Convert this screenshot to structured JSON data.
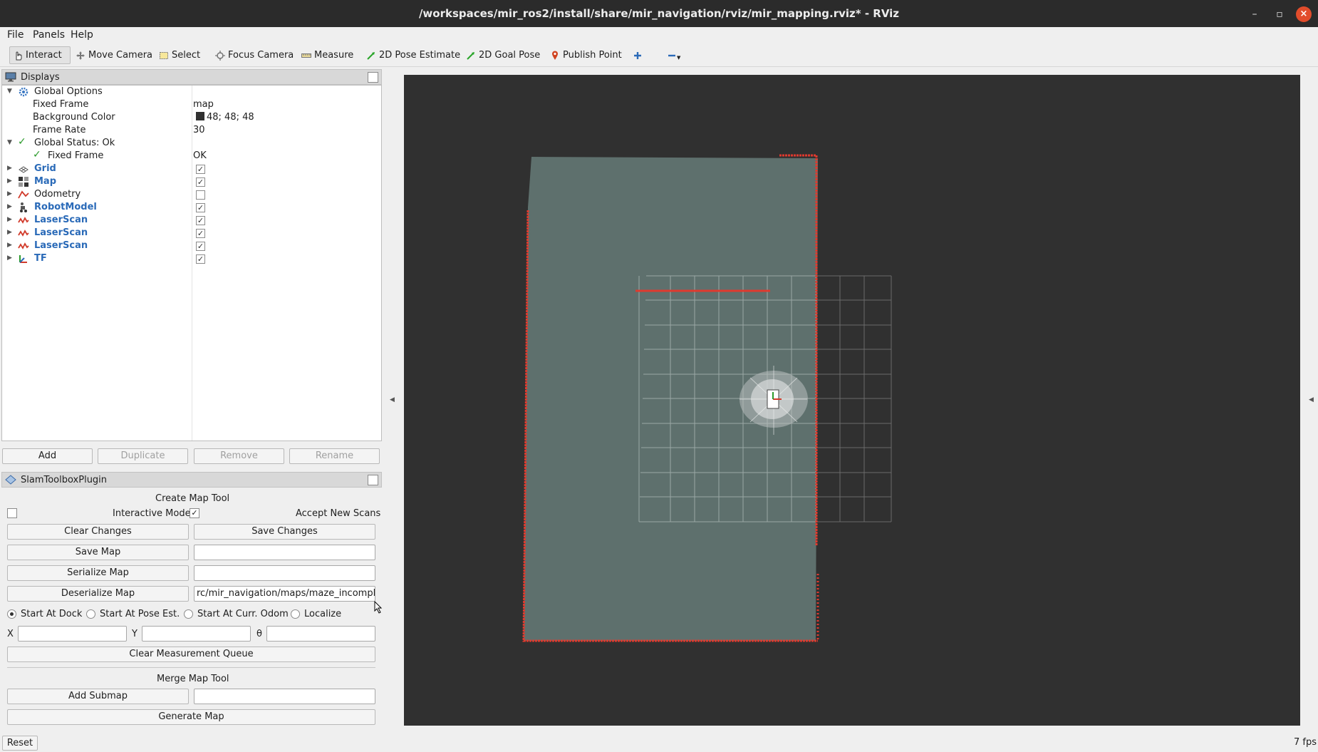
{
  "window": {
    "title": "/workspaces/mir_ros2/install/share/mir_navigation/rviz/mir_mapping.rviz* - RViz",
    "minimize": "–",
    "maximize": "▫",
    "close": "×"
  },
  "menubar": [
    "File",
    "Panels",
    "Help"
  ],
  "toolbar": [
    {
      "label": "Interact",
      "icon": "hand-pointer-icon"
    },
    {
      "label": "Move Camera",
      "icon": "move-camera-icon"
    },
    {
      "label": "Select",
      "icon": "select-icon"
    },
    {
      "label": "Focus Camera",
      "icon": "focus-camera-icon"
    },
    {
      "label": "Measure",
      "icon": "measure-icon"
    },
    {
      "label": "2D Pose Estimate",
      "icon": "pose-estimate-icon"
    },
    {
      "label": "2D Goal Pose",
      "icon": "goal-pose-icon"
    },
    {
      "label": "Publish Point",
      "icon": "publish-point-icon"
    }
  ],
  "displays": {
    "title": "Displays",
    "global_options": "Global Options",
    "fixed_frame_label": "Fixed Frame",
    "fixed_frame_value": "map",
    "bg_color_label": "Background Color",
    "bg_color_value": "48; 48; 48",
    "bg_color_hex": "#303030",
    "frame_rate_label": "Frame Rate",
    "frame_rate_value": "30",
    "global_status": "Global Status: Ok",
    "status_fixed_frame": "Fixed Frame",
    "status_fixed_frame_value": "OK",
    "items": [
      {
        "label": "Grid",
        "checked": true
      },
      {
        "label": "Map",
        "checked": true
      },
      {
        "label": "Odometry",
        "checked": false
      },
      {
        "label": "RobotModel",
        "checked": true
      },
      {
        "label": "LaserScan",
        "checked": true
      },
      {
        "label": "LaserScan",
        "checked": true
      },
      {
        "label": "LaserScan",
        "checked": true
      },
      {
        "label": "TF",
        "checked": true
      }
    ],
    "buttons": {
      "add": "Add",
      "duplicate": "Duplicate",
      "remove": "Remove",
      "rename": "Rename"
    }
  },
  "slam": {
    "title": "SlamToolboxPlugin",
    "create_map_tool": "Create Map Tool",
    "interactive_mode": "Interactive Mode",
    "accept_new_scans": "Accept New Scans",
    "clear_changes": "Clear Changes",
    "save_changes": "Save Changes",
    "save_map": "Save Map",
    "serialize_map": "Serialize Map",
    "deserialize_map": "Deserialize Map",
    "deserialize_path": "rc/mir_navigation/maps/maze_incomplete",
    "radios": [
      "Start At Dock",
      "Start At Pose Est.",
      "Start At Curr. Odom",
      "Localize"
    ],
    "x_label": "X",
    "y_label": "Y",
    "theta_label": "θ",
    "clear_measurement_queue": "Clear Measurement Queue",
    "merge_map_tool": "Merge Map Tool",
    "add_submap": "Add Submap",
    "generate_map": "Generate Map"
  },
  "status": {
    "reset": "Reset",
    "fps": "7 fps"
  }
}
